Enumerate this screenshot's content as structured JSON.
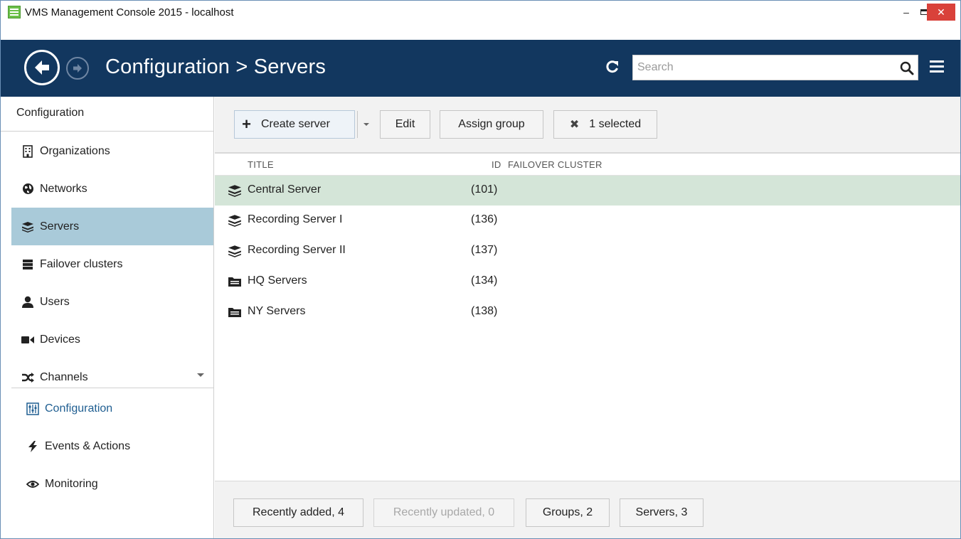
{
  "window": {
    "title": "VMS Management Console 2015 - localhost",
    "controls": {
      "minimize": "–",
      "close": "✕"
    }
  },
  "header": {
    "breadcrumb": "Configuration > Servers",
    "search_placeholder": "Search",
    "search_value": "",
    "color": "#12375f"
  },
  "sidebar": {
    "heading": "Configuration",
    "items": [
      {
        "label": "Organizations",
        "icon": "building-icon"
      },
      {
        "label": "Networks",
        "icon": "globe-icon"
      },
      {
        "label": "Servers",
        "icon": "server-stack-icon",
        "active": true
      },
      {
        "label": "Failover clusters",
        "icon": "cluster-icon"
      },
      {
        "label": "Users",
        "icon": "user-icon"
      },
      {
        "label": "Devices",
        "icon": "camera-icon"
      },
      {
        "label": "Channels",
        "icon": "shuffle-icon"
      }
    ],
    "bottom_items": [
      {
        "label": "Configuration",
        "icon": "sliders-icon",
        "selected": true
      },
      {
        "label": "Events & Actions",
        "icon": "lightning-icon"
      },
      {
        "label": "Monitoring",
        "icon": "eye-icon"
      }
    ],
    "active_color": "#a9cad9"
  },
  "toolbar": {
    "create_label": "Create server",
    "edit_label": "Edit",
    "assign_label": "Assign group",
    "selected_label": "1 selected"
  },
  "list": {
    "columns": {
      "title": "TITLE",
      "id": "ID",
      "failover": "FAILOVER CLUSTER"
    },
    "rows": [
      {
        "title": "Central Server",
        "id": "(101)",
        "icon": "server-stack-icon",
        "active": true
      },
      {
        "title": "Recording Server I",
        "id": "(136)",
        "icon": "server-stack-icon"
      },
      {
        "title": "Recording Server II",
        "id": "(137)",
        "icon": "server-stack-icon"
      },
      {
        "title": "HQ Servers",
        "id": "(134)",
        "icon": "folder-icon"
      },
      {
        "title": "NY Servers",
        "id": "(138)",
        "icon": "folder-icon"
      }
    ],
    "active_color": "#d4e5d8"
  },
  "footer": {
    "recently_added": "Recently added, 4",
    "recently_updated": "Recently updated, 0",
    "groups": "Groups, 2",
    "servers": "Servers, 3"
  }
}
